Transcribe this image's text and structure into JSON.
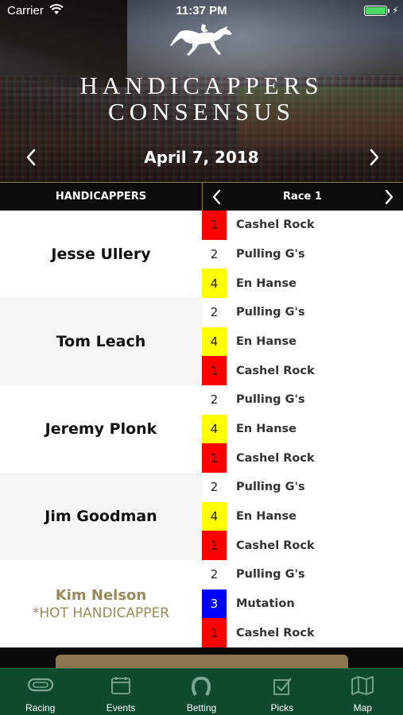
{
  "status_bar": {
    "carrier": "Carrier",
    "time": "11:37 PM"
  },
  "app": {
    "title_line1": "HANDICAPPERS",
    "title_line2": "CONSENSUS",
    "logo_icon": "horse-and-jockey-icon"
  },
  "date_nav": {
    "date": "April 7, 2018",
    "prev_icon": "chevron-left-icon",
    "next_icon": "chevron-right-icon"
  },
  "columns": {
    "handicappers_label": "HANDICAPPERS",
    "race_label": "Race 1"
  },
  "colors": {
    "red": "#ff0000",
    "yellow": "#ffff00",
    "blue": "#0000ff",
    "white": "#ffffff",
    "gold_text": "#9a8a5c",
    "tab_bar": "#0f4a2f",
    "divider": "#8b7a50"
  },
  "handicappers": [
    {
      "name": "Jesse Ullery",
      "note": "",
      "picks": [
        {
          "num": "1",
          "horse": "Cashel Rock",
          "color": "red"
        },
        {
          "num": "2",
          "horse": "Pulling G's",
          "color": "white"
        },
        {
          "num": "4",
          "horse": "En Hanse",
          "color": "yellow"
        }
      ]
    },
    {
      "name": "Tom Leach",
      "note": "",
      "picks": [
        {
          "num": "2",
          "horse": "Pulling G's",
          "color": "white"
        },
        {
          "num": "4",
          "horse": "En Hanse",
          "color": "yellow"
        },
        {
          "num": "1",
          "horse": "Cashel Rock",
          "color": "red"
        }
      ]
    },
    {
      "name": "Jeremy Plonk",
      "note": "",
      "picks": [
        {
          "num": "2",
          "horse": "Pulling G's",
          "color": "white"
        },
        {
          "num": "4",
          "horse": "En Hanse",
          "color": "yellow"
        },
        {
          "num": "1",
          "horse": "Cashel Rock",
          "color": "red"
        }
      ]
    },
    {
      "name": "Jim Goodman",
      "note": "",
      "picks": [
        {
          "num": "2",
          "horse": "Pulling G's",
          "color": "white"
        },
        {
          "num": "4",
          "horse": "En Hanse",
          "color": "yellow"
        },
        {
          "num": "1",
          "horse": "Cashel Rock",
          "color": "red"
        }
      ]
    },
    {
      "name": "Kim Nelson",
      "note": "*HOT HANDICAPPER",
      "picks": [
        {
          "num": "2",
          "horse": "Pulling G's",
          "color": "white"
        },
        {
          "num": "3",
          "horse": "Mutation",
          "color": "blue"
        },
        {
          "num": "1",
          "horse": "Cashel Rock",
          "color": "red"
        }
      ]
    }
  ],
  "tabs": [
    {
      "label": "Racing",
      "icon": "racetrack-icon",
      "selected": true
    },
    {
      "label": "Events",
      "icon": "calendar-icon",
      "selected": false
    },
    {
      "label": "Betting",
      "icon": "horseshoe-icon",
      "selected": false
    },
    {
      "label": "Picks",
      "icon": "checkbox-icon",
      "selected": false
    },
    {
      "label": "Map",
      "icon": "map-icon",
      "selected": false
    }
  ]
}
